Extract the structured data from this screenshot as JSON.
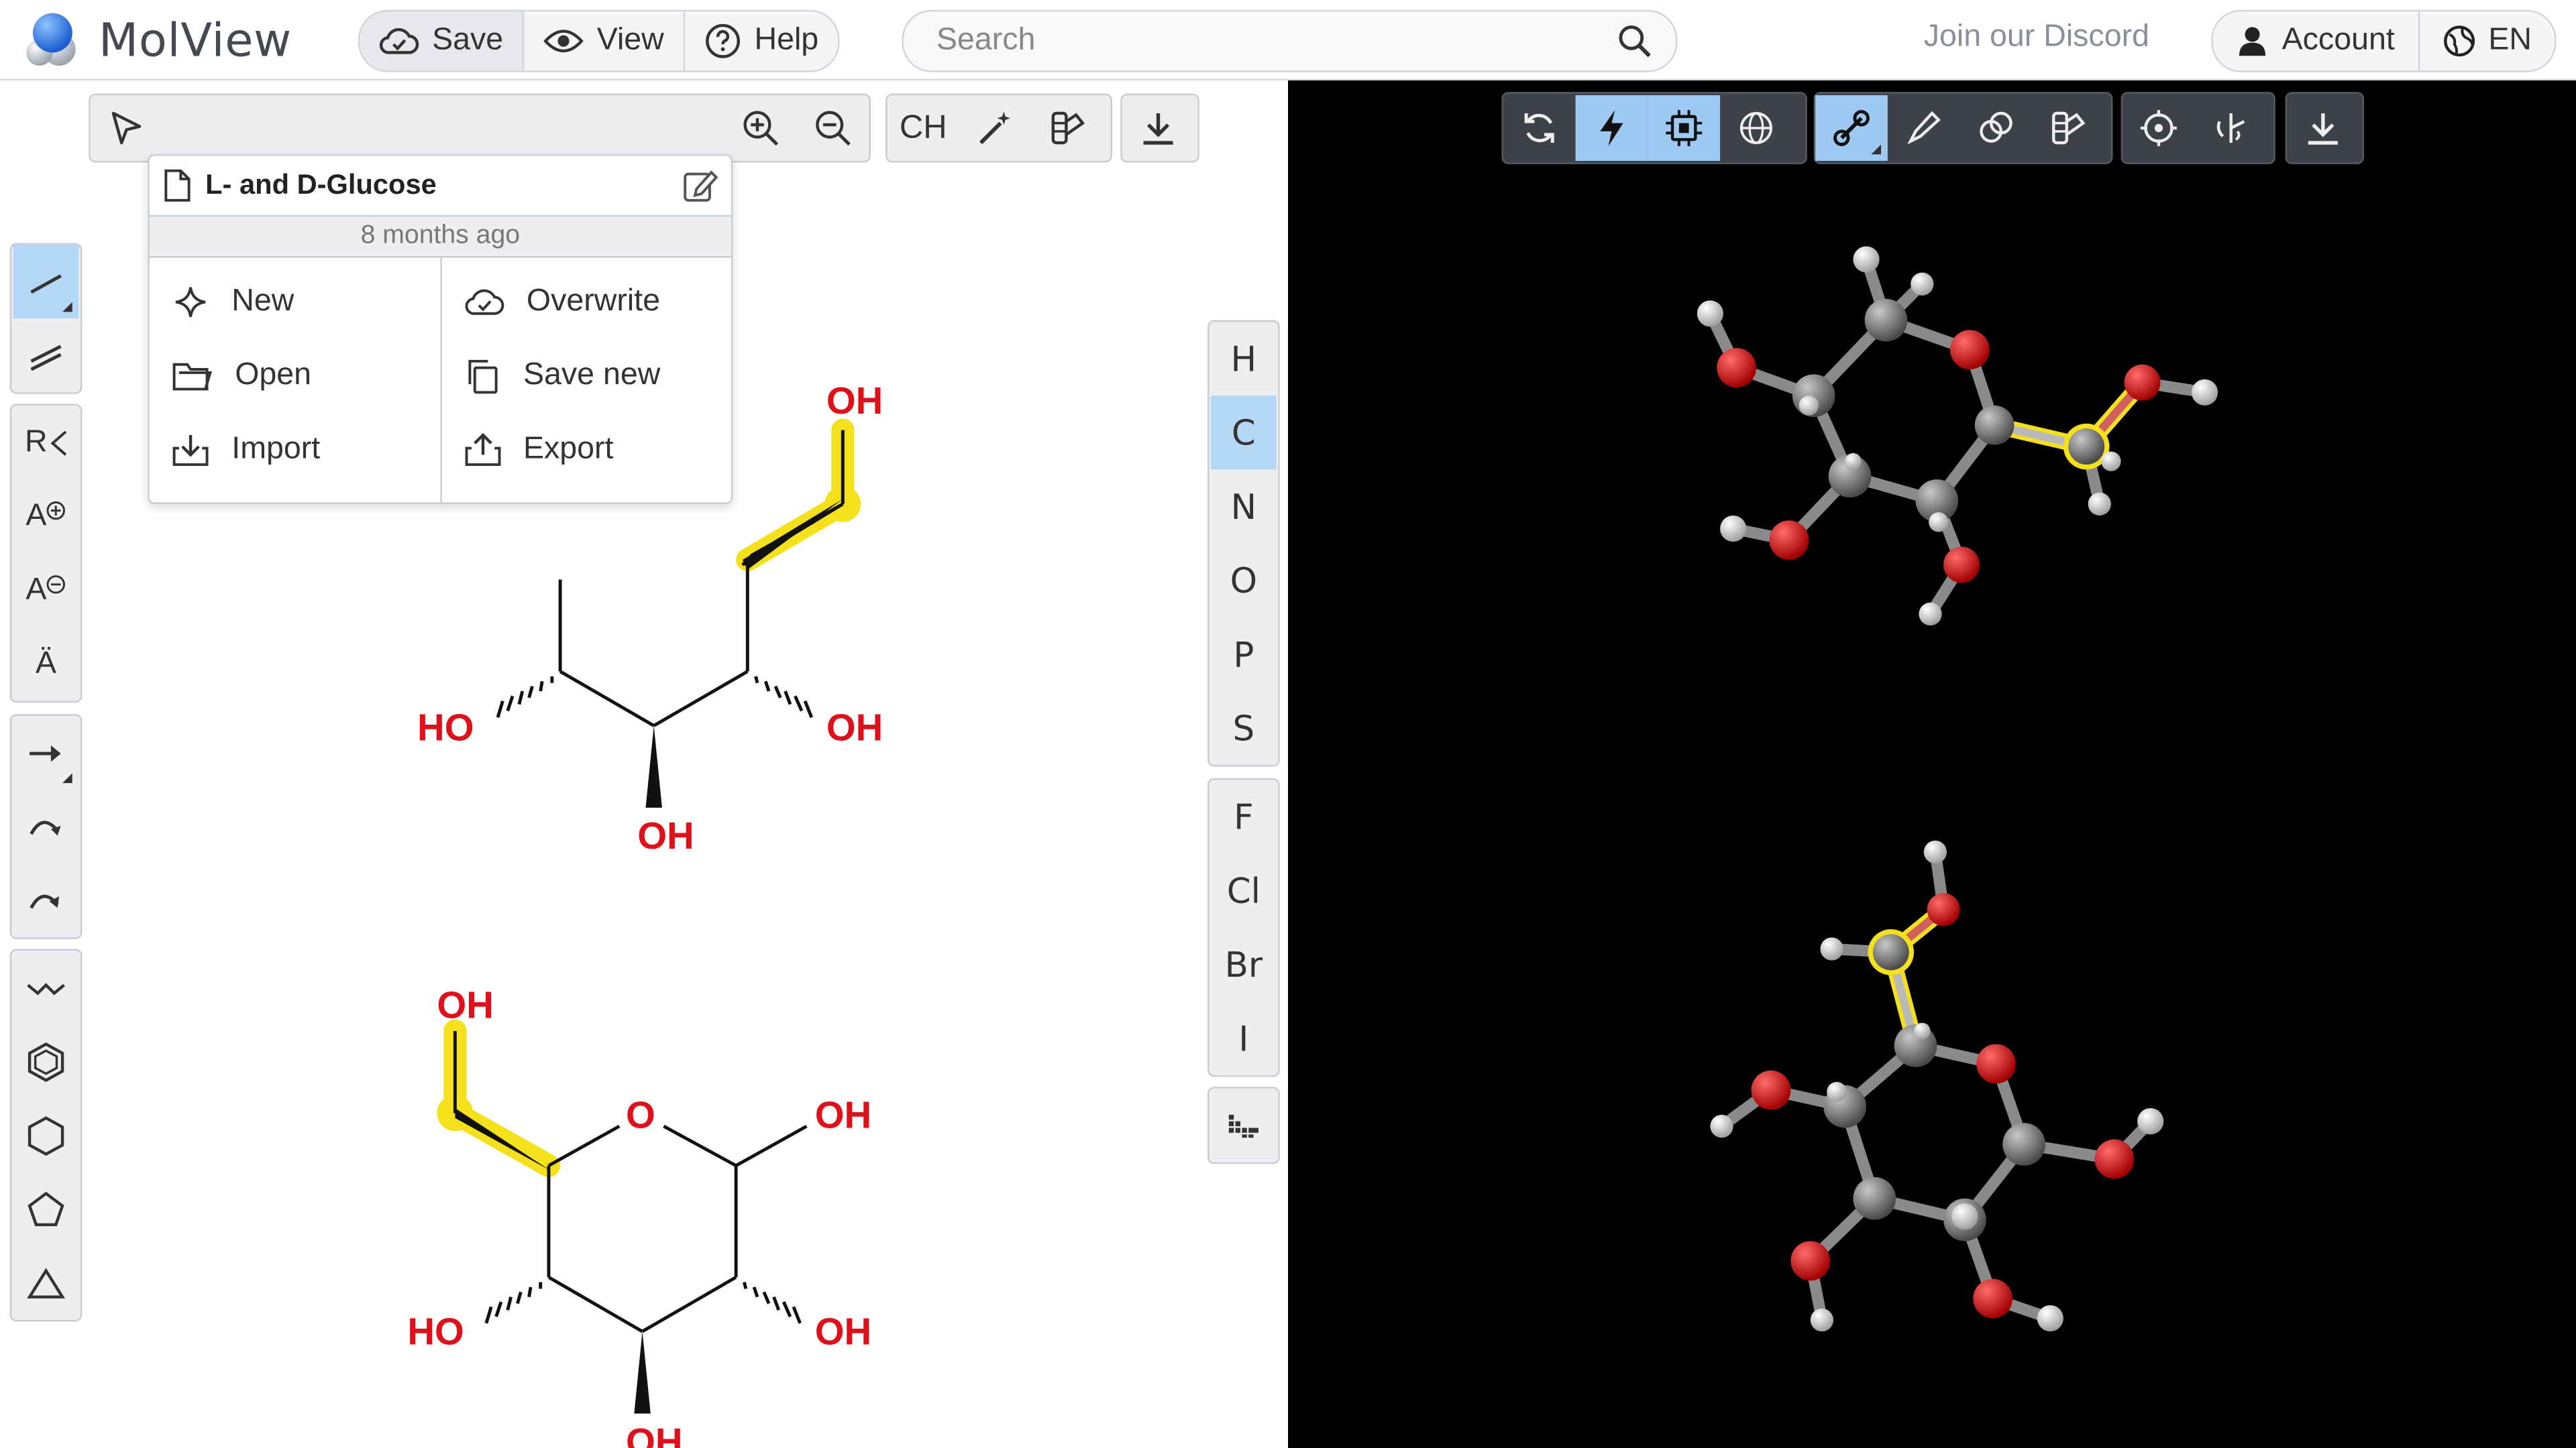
{
  "app": {
    "name": "MolView"
  },
  "header": {
    "menu": [
      {
        "label": "Save",
        "icon": "cloud-check-icon"
      },
      {
        "label": "View",
        "icon": "eye-icon"
      },
      {
        "label": "Help",
        "icon": "question-icon"
      }
    ],
    "search": {
      "placeholder": "Search"
    },
    "discord_link": "Join our Discord",
    "account_label": "Account",
    "language_label": "EN"
  },
  "document_menu": {
    "title": "L- and D-Glucose",
    "modified": "8 months ago",
    "items_left": [
      {
        "label": "New",
        "icon": "sparkle-icon"
      },
      {
        "label": "Open",
        "icon": "folder-icon"
      },
      {
        "label": "Import",
        "icon": "import-icon"
      }
    ],
    "items_right": [
      {
        "label": "Overwrite",
        "icon": "cloud-check-icon"
      },
      {
        "label": "Save new",
        "icon": "copy-icon"
      },
      {
        "label": "Export",
        "icon": "export-icon"
      }
    ]
  },
  "editor_toolbar": {
    "ch_label": "CH"
  },
  "left_toolbar": {
    "r_group_label": "R",
    "charge_plus_label": "A",
    "charge_minus_label": "A",
    "lone_pair_label": "Ä"
  },
  "periodic_table": [
    "H",
    "C",
    "N",
    "O",
    "P",
    "S",
    "F",
    "Cl",
    "Br",
    "I"
  ],
  "structures": {
    "atom_labels": [
      "OH",
      "HO",
      "OH",
      "OH",
      "OH",
      "O",
      "OH",
      "HO",
      "OH",
      "OH"
    ]
  },
  "colors": {
    "accent": "#b5d7f7",
    "oxygen": "#e0101a",
    "highlight": "#f5e11b",
    "viewer_bg": "#000000"
  }
}
